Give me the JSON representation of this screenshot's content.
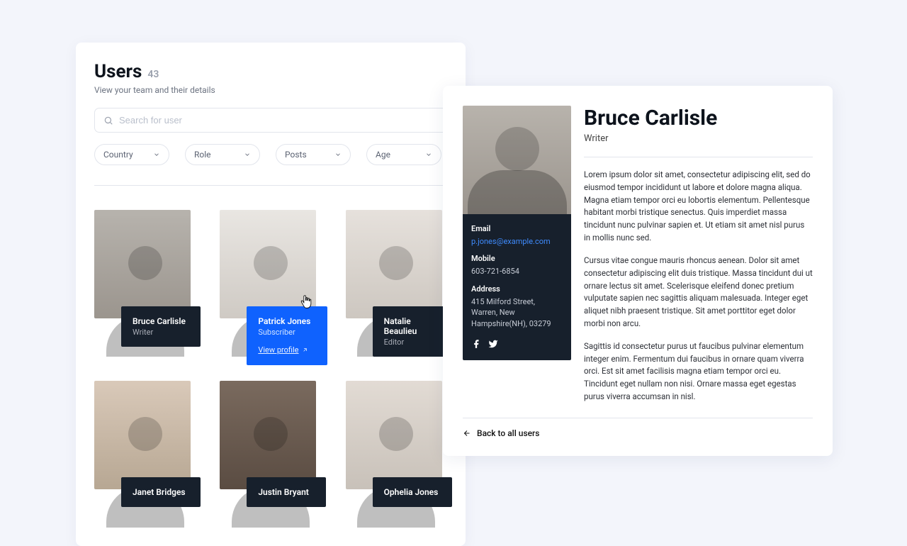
{
  "header": {
    "title": "Users",
    "count": "43",
    "subtitle": "View your team and their details"
  },
  "search": {
    "placeholder": "Search for user"
  },
  "filters": [
    {
      "label": "Country"
    },
    {
      "label": "Role"
    },
    {
      "label": "Posts"
    },
    {
      "label": "Age"
    }
  ],
  "users": [
    {
      "name": "Bruce Carlisle",
      "role": "Writer"
    },
    {
      "name": "Patrick Jones",
      "role": "Subscriber",
      "hovered": true,
      "view_profile": "View profile"
    },
    {
      "name": "Natalie Beaulieu",
      "role": "Editor"
    },
    {
      "name": "Janet Bridges",
      "role": ""
    },
    {
      "name": "Justin Bryant",
      "role": ""
    },
    {
      "name": "Ophelia Jones",
      "role": ""
    }
  ],
  "detail": {
    "name": "Bruce Carlisle",
    "role": "Writer",
    "email_label": "Email",
    "email": "p.jones@example.com",
    "mobile_label": "Mobile",
    "mobile": "603-721-6854",
    "address_label": "Address",
    "address": "415 Milford Street, Warren, New Hampshire(NH), 03279",
    "paragraphs": [
      "Lorem ipsum dolor sit amet, consectetur adipiscing elit, sed do eiusmod tempor incididunt ut labore et dolore magna aliqua. Magna etiam tempor orci eu lobortis elementum. Pellentesque habitant morbi tristique senectus. Quis imperdiet massa tincidunt nunc pulvinar sapien et. Ut etiam sit amet nisl purus in mollis nunc sed.",
      "Cursus vitae congue mauris rhoncus aenean. Dolor sit amet consectetur adipiscing elit duis tristique. Massa tincidunt dui ut ornare lectus sit amet. Scelerisque eleifend donec pretium vulputate sapien nec sagittis aliquam malesuada. Integer eget aliquet nibh praesent tristique. Sit amet porttitor eget dolor morbi non arcu.",
      "Sagittis id consectetur purus ut faucibus pulvinar elementum integer enim. Fermentum dui faucibus in ornare quam viverra orci. Est sit amet facilisis magna etiam tempor orci eu. Tincidunt eget nullam non nisi. Ornare massa eget egestas purus viverra accumsan in nisl."
    ],
    "back": "Back to all users"
  }
}
